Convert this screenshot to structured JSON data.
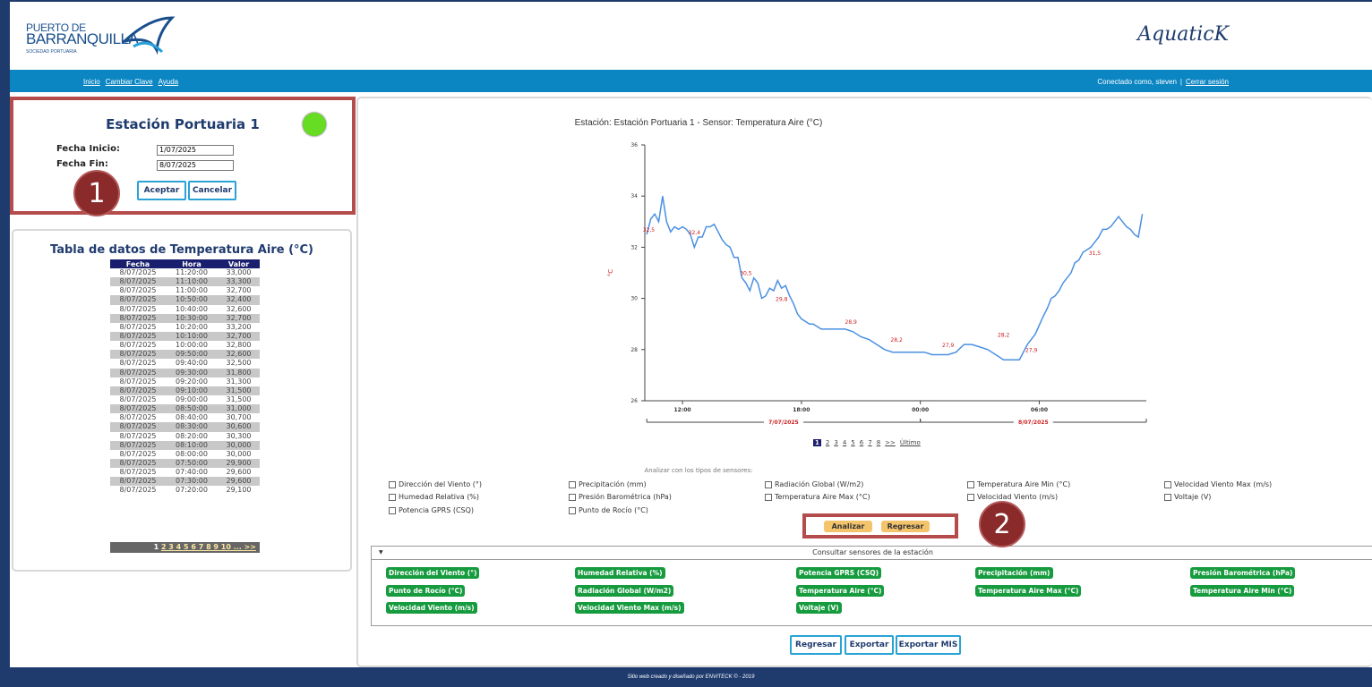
{
  "header": {
    "logo_line1": "PUERTO DE",
    "logo_line2": "BARRANQUILLA",
    "logo_line3": "SOCIEDAD PORTUARIA",
    "brand": "AquaticK"
  },
  "nav": {
    "links": [
      "Inicio",
      "Cambiar Clave",
      "Ayuda"
    ],
    "user_text": "Conectado como, steven",
    "separator": "|",
    "logout": "Cerrar sesión"
  },
  "station": {
    "title": "Estación Portuaria 1",
    "start_label": "Fecha Inicio:",
    "start_value": "1/07/2025",
    "end_label": "Fecha Fin:",
    "end_value": "8/07/2025",
    "accept": "Aceptar",
    "cancel": "Cancelar",
    "status_color": "#66dd22"
  },
  "markers": {
    "m1": "1",
    "m2": "2"
  },
  "table": {
    "title": "Tabla de datos de Temperatura Aire (°C)",
    "columns": [
      "Fecha",
      "Hora",
      "Valor"
    ],
    "rows": [
      [
        "8/07/2025",
        "11:20:00",
        "33,000"
      ],
      [
        "8/07/2025",
        "11:10:00",
        "33,300"
      ],
      [
        "8/07/2025",
        "11:00:00",
        "32,700"
      ],
      [
        "8/07/2025",
        "10:50:00",
        "32,400"
      ],
      [
        "8/07/2025",
        "10:40:00",
        "32,600"
      ],
      [
        "8/07/2025",
        "10:30:00",
        "32,700"
      ],
      [
        "8/07/2025",
        "10:20:00",
        "33,200"
      ],
      [
        "8/07/2025",
        "10:10:00",
        "32,700"
      ],
      [
        "8/07/2025",
        "10:00:00",
        "32,800"
      ],
      [
        "8/07/2025",
        "09:50:00",
        "32,600"
      ],
      [
        "8/07/2025",
        "09:40:00",
        "32,500"
      ],
      [
        "8/07/2025",
        "09:30:00",
        "31,800"
      ],
      [
        "8/07/2025",
        "09:20:00",
        "31,300"
      ],
      [
        "8/07/2025",
        "09:10:00",
        "31,500"
      ],
      [
        "8/07/2025",
        "09:00:00",
        "31,500"
      ],
      [
        "8/07/2025",
        "08:50:00",
        "31,000"
      ],
      [
        "8/07/2025",
        "08:40:00",
        "30,700"
      ],
      [
        "8/07/2025",
        "08:30:00",
        "30,600"
      ],
      [
        "8/07/2025",
        "08:20:00",
        "30,300"
      ],
      [
        "8/07/2025",
        "08:10:00",
        "30,000"
      ],
      [
        "8/07/2025",
        "08:00:00",
        "30,000"
      ],
      [
        "8/07/2025",
        "07:50:00",
        "29,900"
      ],
      [
        "8/07/2025",
        "07:40:00",
        "29,600"
      ],
      [
        "8/07/2025",
        "07:30:00",
        "29,600"
      ],
      [
        "8/07/2025",
        "07:20:00",
        "29,100"
      ]
    ],
    "pager_current": "1",
    "pager_links": "2 3 4 5 6 7 8 9 10 ... >>"
  },
  "chart_data": {
    "type": "line",
    "title": "Estación: Estación Portuaria 1  -  Sensor: Temperatura Aire (°C)",
    "ylabel": "°C",
    "ylim": [
      26,
      36
    ],
    "yticks": [
      "26",
      "28",
      "30",
      "32",
      "34",
      "36"
    ],
    "xticks": [
      "12:00",
      "18:00",
      "00:00",
      "06:00"
    ],
    "xtick_hours": [
      12,
      18,
      24,
      30
    ],
    "xlim_hours": [
      10.1,
      35.4
    ],
    "date_labels": [
      "7/07/2025",
      "8/07/2025"
    ],
    "line_color": "#4a90e2",
    "label_color": "#cc2222",
    "series": [
      {
        "x_hours": [
          10.2,
          10.4,
          10.6,
          10.8,
          11.0,
          11.2,
          11.4,
          11.6,
          11.8,
          12.0,
          12.2,
          12.4,
          12.6,
          12.8,
          13.0,
          13.2,
          13.4,
          13.6,
          13.8,
          14.0,
          14.2,
          14.4,
          14.6,
          14.8,
          15.0,
          15.2,
          15.4,
          15.6,
          15.8,
          16.0,
          16.2,
          16.4,
          16.6,
          16.8,
          17.0,
          17.2,
          17.4,
          17.6,
          17.8,
          18.0,
          18.2,
          18.4,
          18.6,
          18.8,
          19.0,
          19.4,
          19.8,
          20.2,
          20.6,
          21.0,
          21.4,
          21.8,
          22.2,
          22.6,
          23.0,
          23.4,
          23.8,
          24.2,
          24.6,
          25.0,
          25.4,
          25.8,
          26.2,
          26.6,
          27.0,
          27.4,
          27.8,
          28.2,
          28.6,
          29.0,
          29.4,
          29.8,
          30.2,
          30.4,
          30.6,
          30.8,
          31.0,
          31.2,
          31.4,
          31.6,
          31.8,
          32.0,
          32.2,
          32.4,
          32.6,
          32.8,
          33.0,
          33.2,
          33.4,
          33.6,
          33.8,
          34.0,
          34.2,
          34.4,
          34.6,
          34.8,
          35.0,
          35.2
        ],
        "values": [
          32.5,
          33.1,
          33.3,
          33.0,
          34.0,
          33.0,
          32.6,
          32.8,
          32.7,
          32.8,
          32.7,
          32.5,
          32.0,
          32.4,
          32.4,
          32.8,
          32.8,
          32.9,
          32.6,
          32.3,
          32.1,
          32.0,
          31.6,
          31.6,
          30.8,
          30.6,
          30.3,
          30.8,
          30.6,
          30.0,
          30.1,
          30.4,
          30.3,
          30.7,
          30.4,
          30.5,
          30.1,
          29.8,
          29.4,
          29.2,
          29.1,
          29.0,
          29.0,
          28.9,
          28.8,
          28.8,
          28.8,
          28.8,
          28.7,
          28.5,
          28.4,
          28.2,
          28.0,
          27.9,
          27.9,
          27.9,
          27.9,
          27.9,
          27.8,
          27.8,
          27.8,
          27.9,
          28.2,
          28.2,
          28.1,
          28.0,
          27.8,
          27.6,
          27.6,
          27.6,
          28.2,
          28.6,
          29.3,
          29.6,
          30.0,
          30.1,
          30.3,
          30.6,
          30.8,
          31.0,
          31.4,
          31.5,
          31.8,
          31.9,
          32.0,
          32.2,
          32.4,
          32.7,
          32.7,
          32.8,
          33.0,
          33.2,
          33.0,
          32.8,
          32.7,
          32.5,
          32.4,
          33.3
        ]
      }
    ],
    "point_labels": [
      {
        "x_hours": 10.3,
        "value": 32.5,
        "text": "32,5"
      },
      {
        "x_hours": 12.6,
        "value": 32.4,
        "text": "32,4"
      },
      {
        "x_hours": 15.2,
        "value": 30.8,
        "text": "30,5"
      },
      {
        "x_hours": 17.0,
        "value": 29.8,
        "text": "29,8"
      },
      {
        "x_hours": 20.5,
        "value": 28.9,
        "text": "28,9"
      },
      {
        "x_hours": 22.8,
        "value": 28.2,
        "text": "28,2"
      },
      {
        "x_hours": 25.4,
        "value": 28.0,
        "text": "27,9"
      },
      {
        "x_hours": 28.2,
        "value": 28.4,
        "text": "28,2"
      },
      {
        "x_hours": 29.6,
        "value": 27.8,
        "text": "27,9"
      },
      {
        "x_hours": 32.8,
        "value": 31.6,
        "text": "31,5"
      }
    ]
  },
  "chart_pager": {
    "current": "1",
    "pages": [
      "2",
      "3",
      "4",
      "5",
      "6",
      "7",
      "8",
      ">>",
      "Último"
    ]
  },
  "analyze": {
    "label": "Analizar con los tipos de sensores:",
    "checkboxes": [
      [
        "Dirección del Viento (°)",
        "Precipitación (mm)",
        "Radiación Global (W/m2)",
        "Temperatura Aire Min (°C)",
        "Velocidad Viento Max (m/s)"
      ],
      [
        "Humedad Relativa (%)",
        "Presión Barométrica (hPa)",
        "Temperatura Aire Max (°C)",
        "Velocidad Viento (m/s)",
        "Voltaje (V)"
      ],
      [
        "Potencia GPRS (CSQ)",
        "Punto de Rocío (°C)"
      ]
    ],
    "analyze_btn": "Analizar",
    "back_btn": "Regresar"
  },
  "sensors": {
    "header": "Consultar sensores de la estación",
    "buttons": [
      [
        "Dirección del Viento (°)",
        "Humedad Relativa (%)",
        "Potencia GPRS (CSQ)",
        "Precipitación (mm)",
        "Presión Barométrica (hPa)"
      ],
      [
        "Punto de Rocío (°C)",
        "Radiación Global (W/m2)",
        "Temperatura Aire (°C)",
        "Temperatura Aire Max (°C)",
        "Temperatura Aire Min (°C)"
      ],
      [
        "Velocidad Viento (m/s)",
        "Velocidad Viento Max (m/s)",
        "Voltaje (V)"
      ]
    ],
    "button_color": "#179b3f"
  },
  "actions": {
    "back": "Regresar",
    "export": "Exportar",
    "export_mis": "Exportar MIS"
  },
  "footer": {
    "text": "Sitio web creado y diseñado por ENVITECK © - 2019"
  }
}
